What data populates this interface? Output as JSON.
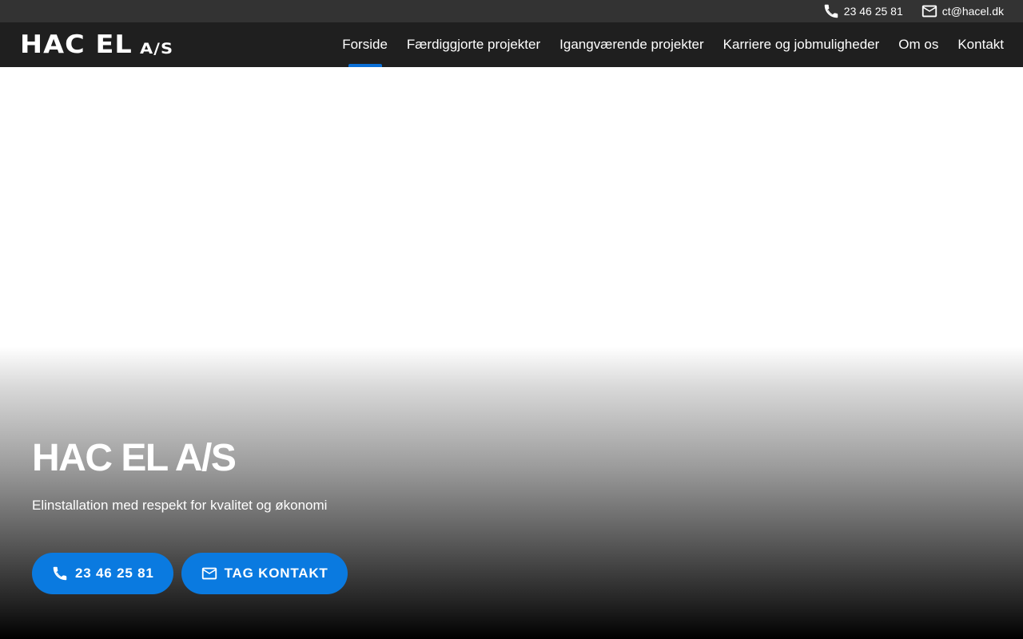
{
  "topbar": {
    "phone": "23 46 25 81",
    "email": "ct@hacel.dk",
    "phone_icon": "phone-icon",
    "email_icon": "mail-icon"
  },
  "header": {
    "logo_main": "HAC EL",
    "logo_suffix": "A/S"
  },
  "nav": {
    "items": [
      {
        "label": "Forside",
        "active": true
      },
      {
        "label": "Færdiggjorte projekter",
        "active": false
      },
      {
        "label": "Igangværende projekter",
        "active": false
      },
      {
        "label": "Karriere og jobmuligheder",
        "active": false
      },
      {
        "label": "Om os",
        "active": false
      },
      {
        "label": "Kontakt",
        "active": false
      }
    ]
  },
  "hero": {
    "title": "HAC EL A/S",
    "subtitle": "Elinstallation med respekt for kvalitet og økonomi",
    "buttons": {
      "call_label": "23 46 25 81",
      "contact_label": "TAG KONTAKT"
    }
  },
  "colors": {
    "topbar_bg": "#333333",
    "navbar_bg": "#1f1f1f",
    "accent": "#0a7ae0",
    "active_indicator": "#0a6fd6",
    "text": "#ffffff"
  }
}
